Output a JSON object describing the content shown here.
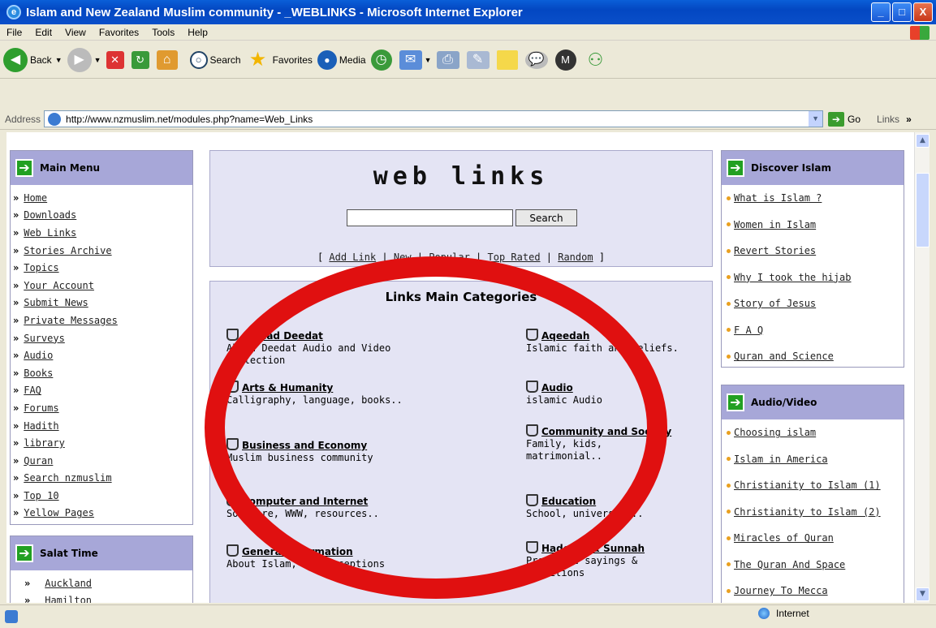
{
  "window": {
    "title": "Islam and New Zealand Muslim community - _WEBLINKS - Microsoft Internet Explorer",
    "min": "_",
    "max": "□",
    "close": "X"
  },
  "menubar": [
    "File",
    "Edit",
    "View",
    "Favorites",
    "Tools",
    "Help"
  ],
  "toolbar": {
    "back": "Back",
    "search": "Search",
    "favorites": "Favorites",
    "media": "Media"
  },
  "address": {
    "label": "Address",
    "url": "http://www.nzmuslim.net/modules.php?name=Web_Links",
    "go": "Go",
    "links": "Links"
  },
  "main_menu": {
    "title": "Main Menu",
    "items": [
      "Home",
      "Downloads",
      "Web Links",
      "Stories Archive",
      "Topics",
      "Your Account",
      "Submit News",
      "Private Messages",
      "Surveys",
      "Audio",
      "Books",
      "FAQ",
      "Forums",
      "Hadith",
      "library",
      "Quran",
      "Search nzmuslim",
      "Top 10",
      "Yellow Pages"
    ]
  },
  "salat": {
    "title": "Salat Time",
    "items": [
      "Auckland",
      "Hamilton"
    ]
  },
  "center": {
    "logo": "web links",
    "search_button": "Search",
    "nav": [
      "Add Link",
      "New",
      "Popular",
      "Top Rated",
      "Random"
    ]
  },
  "categories": {
    "title": "Links Main Categories",
    "left": [
      {
        "name": "Ahmad Deedat",
        "desc": "Ahmad Deedat Audio and Video Collection"
      },
      {
        "name": "Arts & Humanity",
        "desc": "Calligraphy, language, books.."
      },
      {
        "name": "Business and Economy",
        "desc": "Muslim business community"
      },
      {
        "name": "Computer and Internet",
        "desc": "Software, WWW, resources.."
      },
      {
        "name": "General Information",
        "desc": "About Islam, misconceptions"
      }
    ],
    "right": [
      {
        "name": "Aqeedah",
        "desc": "Islamic faith and beliefs."
      },
      {
        "name": "Audio",
        "desc": "islamic Audio"
      },
      {
        "name": "Community and Society",
        "desc": "Family, kids, matrimonial.."
      },
      {
        "name": "Education",
        "desc": "School, university.."
      },
      {
        "name": "Hadeeth & Sunnah",
        "desc": "Prophetic sayings & traditions"
      }
    ]
  },
  "discover": {
    "title": "Discover Islam",
    "items": [
      "What is Islam ?",
      "Women in Islam",
      "Revert Stories",
      "Why I took the hijab",
      "Story of Jesus",
      "F A Q",
      "Quran and Science"
    ]
  },
  "audio_video": {
    "title": "Audio/Video",
    "items": [
      "Choosing islam",
      "Islam in America",
      "Christianity to Islam (1)",
      "Christianity to Islam (2)",
      "Miracles of Quran",
      "The Quran And Space",
      "Journey To Mecca"
    ]
  },
  "status": {
    "zone": "Internet"
  },
  "colors": {
    "accent_red": "#e01010",
    "box_header": "#a7a7d8",
    "titlebar": "#0347c2"
  }
}
